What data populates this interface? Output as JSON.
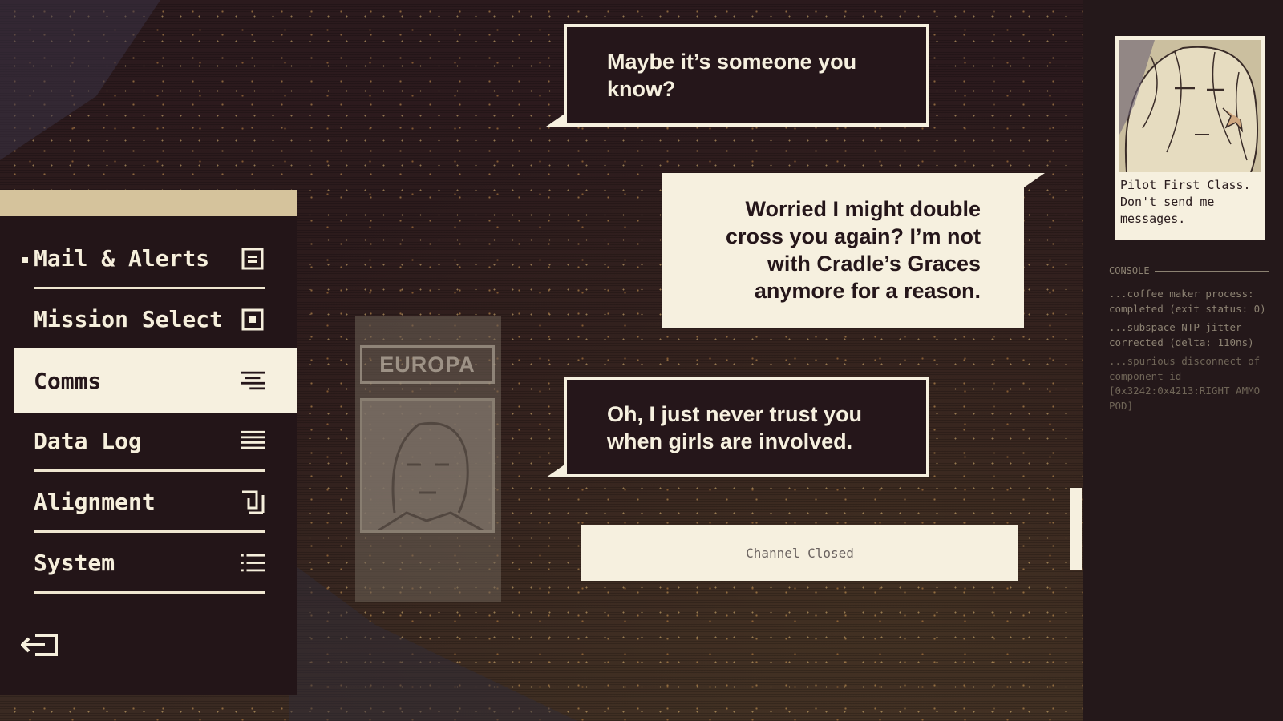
{
  "menu": {
    "items": [
      {
        "label": "Mail & Alerts",
        "icon": "mail-icon",
        "active": false
      },
      {
        "label": "Mission Select",
        "icon": "target-icon",
        "active": false
      },
      {
        "label": "Comms",
        "icon": "comms-icon",
        "active": true
      },
      {
        "label": "Data Log",
        "icon": "list-icon",
        "active": false
      },
      {
        "label": "Alignment",
        "icon": "alignment-icon",
        "active": false
      },
      {
        "label": "System",
        "icon": "system-list-icon",
        "active": false
      }
    ],
    "exit_icon": "exit-icon"
  },
  "dossier": {
    "name": "EUROPA"
  },
  "chat": {
    "messages": [
      {
        "side": "left",
        "text": "Maybe it’s someone you know?"
      },
      {
        "side": "right",
        "text": "Worried I might double cross you again? I’m not with Cradle’s Graces anymore for a reason."
      },
      {
        "side": "left",
        "text": "Oh, I just never trust you when girls are involved."
      }
    ],
    "status": "Channel Closed"
  },
  "profile": {
    "caption": "Pilot First Class. Don't send me messages."
  },
  "console": {
    "title": "CONSOLE",
    "lines": [
      "...coffee maker process: completed (exit status: 0)",
      "...subspace NTP jitter corrected (delta: 110ns)",
      "...spurious disconnect of component id [0x3242:0x4213:RIGHT AMMO POD]"
    ]
  },
  "colors": {
    "cream": "#f6f0df",
    "dark": "#25161a",
    "band": "#d5c39c",
    "console_text": "#8c8272"
  }
}
